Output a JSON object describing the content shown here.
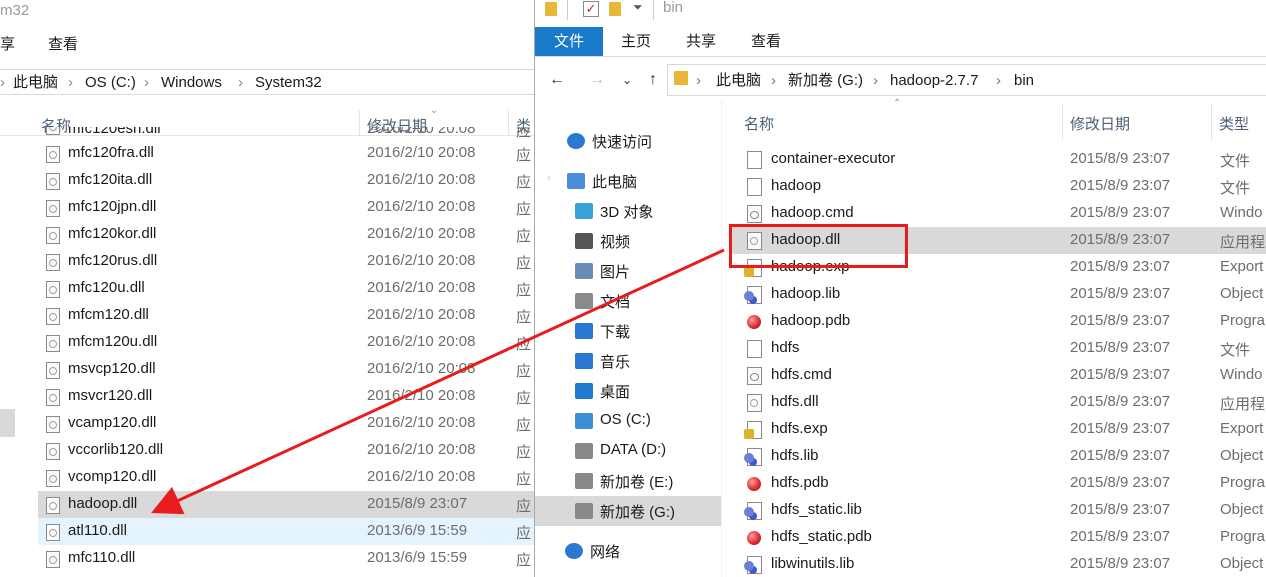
{
  "left": {
    "title": "m32",
    "ribbon": [
      "享",
      "查看"
    ],
    "breadcrumb": [
      "此电脑",
      "OS (C:)",
      "Windows",
      "System32"
    ],
    "columns": [
      "名称",
      "修改日期",
      "类"
    ],
    "partial_top_row": {
      "name": "mfc120esn.dll",
      "date": "2016/2/10 20:08",
      "type": "应"
    },
    "rows": [
      {
        "name": "mfc120fra.dll",
        "date": "2016/2/10 20:08",
        "type": "应",
        "state": ""
      },
      {
        "name": "mfc120ita.dll",
        "date": "2016/2/10 20:08",
        "type": "应",
        "state": ""
      },
      {
        "name": "mfc120jpn.dll",
        "date": "2016/2/10 20:08",
        "type": "应",
        "state": ""
      },
      {
        "name": "mfc120kor.dll",
        "date": "2016/2/10 20:08",
        "type": "应",
        "state": ""
      },
      {
        "name": "mfc120rus.dll",
        "date": "2016/2/10 20:08",
        "type": "应",
        "state": ""
      },
      {
        "name": "mfc120u.dll",
        "date": "2016/2/10 20:08",
        "type": "应",
        "state": ""
      },
      {
        "name": "mfcm120.dll",
        "date": "2016/2/10 20:08",
        "type": "应",
        "state": ""
      },
      {
        "name": "mfcm120u.dll",
        "date": "2016/2/10 20:08",
        "type": "应",
        "state": ""
      },
      {
        "name": "msvcp120.dll",
        "date": "2016/2/10 20:08",
        "type": "应",
        "state": ""
      },
      {
        "name": "msvcr120.dll",
        "date": "2016/2/10 20:08",
        "type": "应",
        "state": ""
      },
      {
        "name": "vcamp120.dll",
        "date": "2016/2/10 20:08",
        "type": "应",
        "state": ""
      },
      {
        "name": "vccorlib120.dll",
        "date": "2016/2/10 20:08",
        "type": "应",
        "state": ""
      },
      {
        "name": "vcomp120.dll",
        "date": "2016/2/10 20:08",
        "type": "应",
        "state": ""
      },
      {
        "name": "hadoop.dll",
        "date": "2015/8/9 23:07",
        "type": "应",
        "state": "sel"
      },
      {
        "name": "atl110.dll",
        "date": "2013/6/9 15:59",
        "type": "应",
        "state": "hov"
      },
      {
        "name": "mfc110.dll",
        "date": "2013/6/9 15:59",
        "type": "应",
        "state": ""
      }
    ]
  },
  "right": {
    "title": "bin",
    "ribbon": {
      "file": "文件",
      "tabs": [
        "主页",
        "共享",
        "查看"
      ]
    },
    "breadcrumb": [
      "此电脑",
      "新加卷 (G:)",
      "hadoop-2.7.7",
      "bin"
    ],
    "nav": [
      {
        "label": "快速访问",
        "icon": "star-icon",
        "color": "#2b78d0"
      },
      {
        "label": "此电脑",
        "icon": "computer-icon",
        "color": "#4a8fd8"
      },
      {
        "label": "3D 对象",
        "icon": "cube-icon",
        "color": "#3aa0d8"
      },
      {
        "label": "视频",
        "icon": "film-icon",
        "color": "#555555"
      },
      {
        "label": "图片",
        "icon": "picture-icon",
        "color": "#6a8bb8"
      },
      {
        "label": "文档",
        "icon": "document-icon",
        "color": "#8a8a8a"
      },
      {
        "label": "下载",
        "icon": "download-icon",
        "color": "#2b78d0"
      },
      {
        "label": "音乐",
        "icon": "music-icon",
        "color": "#2b78d0"
      },
      {
        "label": "桌面",
        "icon": "desktop-icon",
        "color": "#1e7bd0"
      },
      {
        "label": "OS (C:)",
        "icon": "windows-drive-icon",
        "color": "#3a8ed8"
      },
      {
        "label": "DATA (D:)",
        "icon": "drive-icon",
        "color": "#888888"
      },
      {
        "label": "新加卷 (E:)",
        "icon": "drive-icon",
        "color": "#888888"
      },
      {
        "label": "新加卷 (G:)",
        "icon": "drive-icon",
        "color": "#888888"
      },
      {
        "label": "网络",
        "icon": "network-icon",
        "color": "#2b78d0"
      }
    ],
    "columns": [
      "名称",
      "修改日期",
      "类型"
    ],
    "files": [
      {
        "name": "container-executor",
        "date": "2015/8/9 23:07",
        "type": "文件",
        "icon": "blank"
      },
      {
        "name": "hadoop",
        "date": "2015/8/9 23:07",
        "type": "文件",
        "icon": "blank"
      },
      {
        "name": "hadoop.cmd",
        "date": "2015/8/9 23:07",
        "type": "Windo",
        "icon": "cmd"
      },
      {
        "name": "hadoop.dll",
        "date": "2015/8/9 23:07",
        "type": "应用程",
        "icon": "dll"
      },
      {
        "name": "hadoop.exp",
        "date": "2015/8/9 23:07",
        "type": "Export",
        "icon": "exp"
      },
      {
        "name": "hadoop.lib",
        "date": "2015/8/9 23:07",
        "type": "Object",
        "icon": "lib"
      },
      {
        "name": "hadoop.pdb",
        "date": "2015/8/9 23:07",
        "type": "Progra",
        "icon": "pdb"
      },
      {
        "name": "hdfs",
        "date": "2015/8/9 23:07",
        "type": "文件",
        "icon": "blank"
      },
      {
        "name": "hdfs.cmd",
        "date": "2015/8/9 23:07",
        "type": "Windo",
        "icon": "cmd"
      },
      {
        "name": "hdfs.dll",
        "date": "2015/8/9 23:07",
        "type": "应用程",
        "icon": "dll"
      },
      {
        "name": "hdfs.exp",
        "date": "2015/8/9 23:07",
        "type": "Export",
        "icon": "exp"
      },
      {
        "name": "hdfs.lib",
        "date": "2015/8/9 23:07",
        "type": "Object",
        "icon": "lib"
      },
      {
        "name": "hdfs.pdb",
        "date": "2015/8/9 23:07",
        "type": "Progra",
        "icon": "pdb"
      },
      {
        "name": "hdfs_static.lib",
        "date": "2015/8/9 23:07",
        "type": "Object",
        "icon": "lib"
      },
      {
        "name": "hdfs_static.pdb",
        "date": "2015/8/9 23:07",
        "type": "Progra",
        "icon": "pdb"
      },
      {
        "name": "libwinutils.lib",
        "date": "2015/8/9 23:07",
        "type": "Object",
        "icon": "lib"
      }
    ],
    "selected_index": 3
  },
  "colors": {
    "accent": "#1979ca",
    "annotation": "#e81c1c",
    "selection": "#d9d9d9",
    "hover": "#e5f3ff"
  }
}
